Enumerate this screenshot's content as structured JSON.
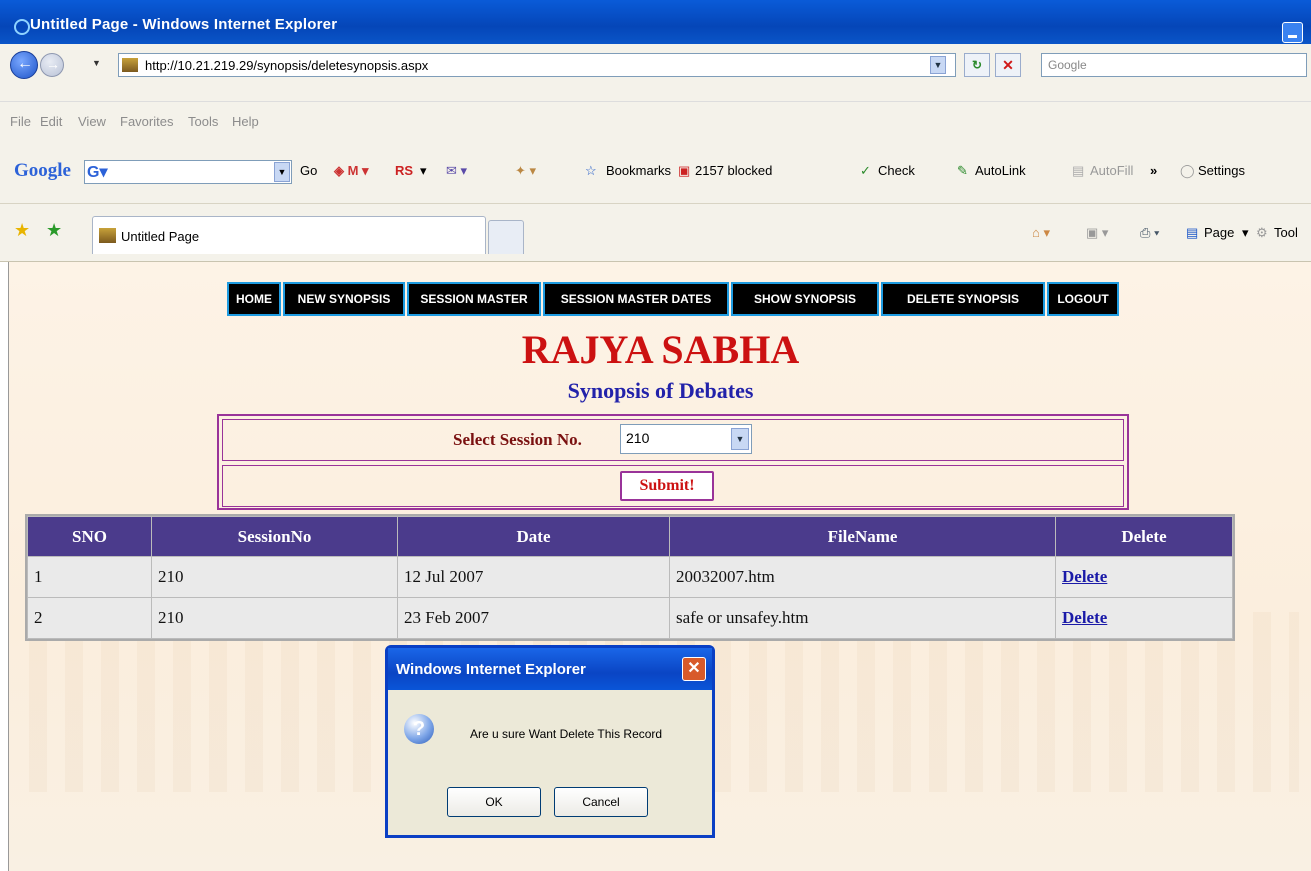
{
  "window": {
    "title": "Untitled Page - Windows Internet Explorer"
  },
  "address_bar": {
    "url": "http://10.21.219.29/synopsis/deletesynopsis.aspx",
    "search_placeholder": "Google"
  },
  "menu": [
    "File",
    "Edit",
    "View",
    "Favorites",
    "Tools",
    "Help"
  ],
  "google_toolbar": {
    "logo": "Google",
    "go": "Go",
    "rs": "RS",
    "bookmarks": "Bookmarks",
    "blocked": "2157 blocked",
    "check": "Check",
    "autolink": "AutoLink",
    "autofill": "AutoFill",
    "more": "»",
    "settings": "Settings"
  },
  "tabs": {
    "active_tab": "Untitled Page",
    "page_menu": "Page",
    "tools_menu": "Tool"
  },
  "site_nav": [
    "HOME",
    "NEW SYNOPSIS",
    "SESSION MASTER",
    "SESSION MASTER DATES",
    "SHOW SYNOPSIS",
    "DELETE SYNOPSIS",
    "LOGOUT"
  ],
  "page": {
    "heading": "RAJYA SABHA",
    "subheading": "Synopsis of Debates",
    "session_label": "Select Session No.",
    "session_value": "210",
    "submit_label": "Submit!"
  },
  "grid": {
    "columns": [
      "SNO",
      "SessionNo",
      "Date",
      "FileName",
      "Delete"
    ],
    "rows": [
      {
        "sno": "1",
        "session": "210",
        "date": "12 Jul 2007",
        "file": "20032007.htm",
        "action": "Delete"
      },
      {
        "sno": "2",
        "session": "210",
        "date": "23 Feb 2007",
        "file": "safe or unsafey.htm",
        "action": "Delete"
      }
    ]
  },
  "dialog": {
    "title": "Windows Internet Explorer",
    "message": "Are u sure Want Delete This Record",
    "ok": "OK",
    "cancel": "Cancel"
  },
  "colors": {
    "nav_bg": "#000000",
    "nav_border": "#1e9be0",
    "heading": "#cc1111",
    "subheading": "#2222aa",
    "grid_header": "#4b3b8c",
    "form_border": "#993399"
  }
}
